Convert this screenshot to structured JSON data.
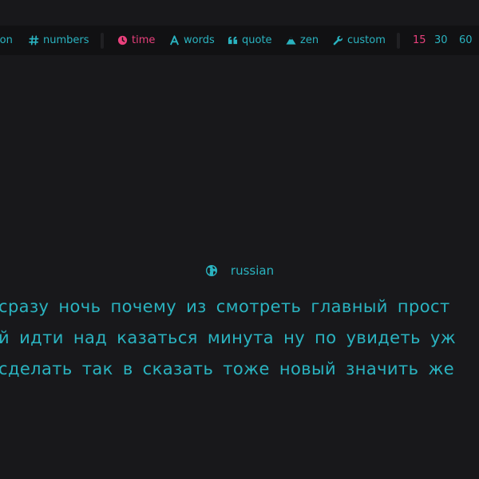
{
  "config": {
    "punctuation_label": "ion",
    "numbers_label": "numbers",
    "modes": {
      "time": "time",
      "words": "words",
      "quote": "quote",
      "zen": "zen",
      "custom": "custom"
    },
    "durations": [
      "15",
      "30",
      "60"
    ],
    "active_mode": "time",
    "active_duration": "15"
  },
  "language": "russian",
  "words": {
    "line1": "сразу ночь почему из смотреть главный прост",
    "line2": "й идти над казаться минута ну по увидеть уж",
    "line3": "сделать так в сказать тоже новый значить же"
  },
  "colors": {
    "background": "#18181b",
    "bar": "#111113",
    "text": "#2ab3c0",
    "accent": "#e9407c"
  }
}
